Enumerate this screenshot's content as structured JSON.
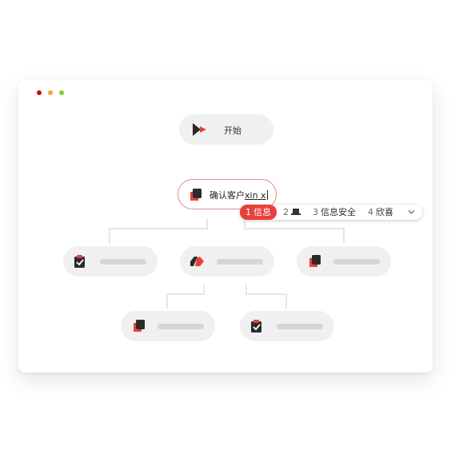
{
  "window_dots": {
    "close": "#d0021b",
    "minimize": "#f5a623",
    "maximize": "#7ed321"
  },
  "start_node": {
    "label": "开始"
  },
  "active_node": {
    "label": "确认客户",
    "input": "xin x"
  },
  "ime": {
    "candidates": [
      {
        "num": "1",
        "text": "信息"
      },
      {
        "num": "2",
        "text": ""
      },
      {
        "num": "3",
        "text": "信息安全"
      },
      {
        "num": "4",
        "text": "欣喜"
      }
    ]
  },
  "colors": {
    "accent": "#e8413c",
    "node_bg": "#f0f0f0",
    "icon_dark": "#2b2b2b"
  }
}
